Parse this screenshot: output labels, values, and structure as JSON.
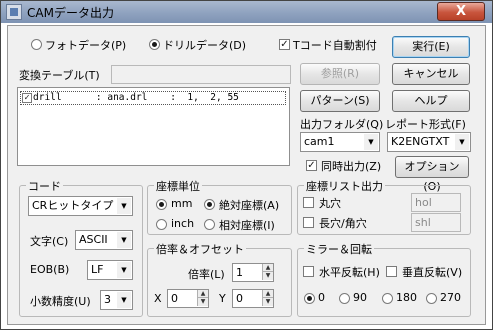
{
  "window": {
    "title": "CAMデータ出力",
    "close_label": "X"
  },
  "buttons": {
    "execute": "実行(E)",
    "cancel": "キャンセル",
    "reference": "参照(R)",
    "help": "ヘルプ",
    "pattern": "パターン(S)",
    "option": "オプション(O)"
  },
  "data_type": {
    "photo_label": "フォトデータ(P)",
    "drill_label": "ドリルデータ(D)",
    "selected": "drill"
  },
  "t_code_auto": {
    "label": "Tコード自動割付",
    "checked": true
  },
  "conversion_table": {
    "label": "変換テーブル(T)",
    "path_value": "",
    "items": [
      {
        "checked": true,
        "text": "drill      : ana.drl    :  1,  2, 55"
      }
    ]
  },
  "output_folder": {
    "label": "出力フォルダ(Q)",
    "value": "cam1"
  },
  "report_format": {
    "label": "レポート形式(F)",
    "value": "K2ENGTXT"
  },
  "simultaneous_output": {
    "label": "同時出力(Z)",
    "checked": true
  },
  "code_group": {
    "title": "コード",
    "code_value": "CRヒットタイプ",
    "char_label": "文字(C)",
    "char_value": "ASCII",
    "eob_label": "EOB(B)",
    "eob_value": "LF",
    "decimal_label": "小数精度(U)",
    "decimal_value": "3"
  },
  "coord_unit": {
    "title": "座標単位",
    "mm_label": "mm",
    "inch_label": "inch",
    "abs_label": "絶対座標(A)",
    "rel_label": "相対座標(I)",
    "unit_selected": "mm",
    "mode_selected": "absolute"
  },
  "coord_list": {
    "title": "座標リスト出力",
    "round_hole_label": "丸穴",
    "round_hole_value": "hol",
    "slot_label": "長穴/角穴",
    "slot_value": "shl"
  },
  "scale_offset": {
    "title": "倍率＆オフセット",
    "scale_label": "倍率(L)",
    "scale_value": "1",
    "x_label": "X",
    "x_value": "0",
    "y_label": "Y",
    "y_value": "0"
  },
  "mirror_rotate": {
    "title": "ミラー＆回転",
    "h_flip_label": "水平反転(H)",
    "v_flip_label": "垂直反転(V)",
    "angles": [
      "0",
      "90",
      "180",
      "270"
    ],
    "angle_selected": "0"
  }
}
